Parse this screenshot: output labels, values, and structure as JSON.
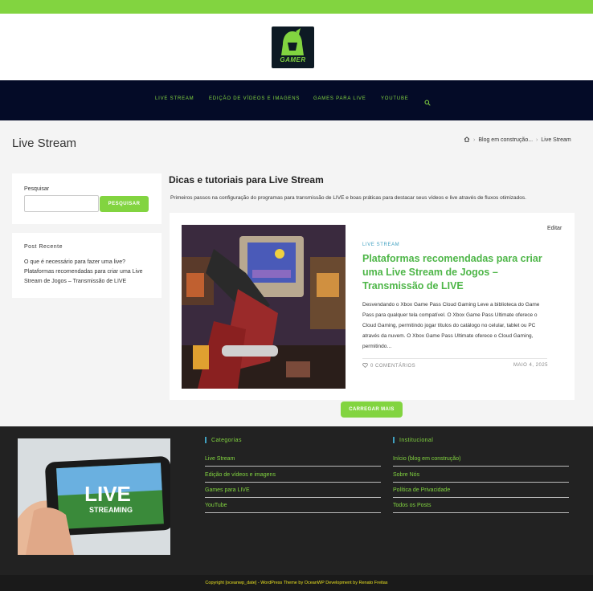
{
  "header": {
    "logo_text": "GAMER",
    "nav": [
      {
        "label": "Live Stream"
      },
      {
        "label": "Edição de vídeos e imagens"
      },
      {
        "label": "Games para LIVE"
      },
      {
        "label": "YouTube"
      }
    ]
  },
  "page": {
    "title": "Live Stream",
    "breadcrumb": [
      "Blog em construção...",
      "Live Stream"
    ]
  },
  "sidebar": {
    "search_label": "Pesquisar",
    "search_value": "",
    "search_button": "PESQUISAR",
    "recent_title": "Post Recente",
    "recent_links": [
      "O que é necessário para fazer uma live?",
      "Plataformas recomendadas para criar uma Live Stream de Jogos – Transmissão de LIVE"
    ]
  },
  "archive": {
    "title": "Dicas e tutoriais para Live Stream",
    "description": "Primeiros passos na configuração do programas para transmissão de LIVE e boas práticas para destacar seus vídeos e live através de fluxos otimizados."
  },
  "post": {
    "edit_label": "Editar",
    "category": "Live Stream",
    "title": "Plataformas recomendadas para criar uma Live Stream de Jogos – Transmissão de LIVE",
    "excerpt": "Desvendando o Xbox Game Pass Cloud Gaming Leve a biblioteca do Game Pass para qualquer tela compatível. O Xbox Game Pass Ultimate oferece o Cloud Gaming, permitindo jogar títulos do catálogo no celular, tablet ou PC através da nuvem. O Xbox Game Pass Ultimate oferece o Cloud Gaming, permitindo…",
    "comments": "0 Comentários",
    "date": "Maio 4, 2025"
  },
  "load_more": "CARREGAR MAIS",
  "footer": {
    "image_text_1": "LIVE",
    "image_text_2": "STREAMING",
    "categories_title": "Categorias",
    "categories": [
      "Live Stream",
      "Edição de vídeos e imagens",
      "Games para LIVE",
      "YouTube"
    ],
    "institutional_title": "Institucional",
    "institutional": [
      "Início (blog em construção)",
      "Sobre Nós",
      "Política de Privacidade",
      "Todos os Posts"
    ],
    "copyright": "Copyright [oceanwp_date] - WordPress Theme by OceanWP Development by Renato Freitas"
  },
  "colors": {
    "accent_green": "#82d440",
    "nav_bg": "#040b27",
    "footer_bg": "#222222",
    "post_title": "#4eb648"
  }
}
